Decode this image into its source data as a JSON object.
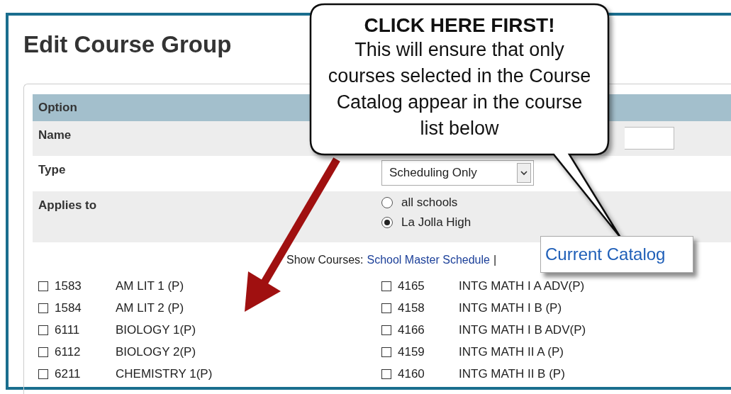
{
  "page": {
    "title": "Edit Course Group"
  },
  "table": {
    "header": "Option",
    "rows": [
      {
        "kind": "input",
        "label": "Name"
      },
      {
        "kind": "select",
        "label": "Type",
        "value": "Scheduling Only"
      },
      {
        "kind": "radio",
        "label": "Applies to",
        "options": [
          {
            "label": "all schools",
            "selected": false
          },
          {
            "label": "La Jolla High",
            "selected": true
          }
        ]
      }
    ]
  },
  "show_courses": {
    "label": "Show Courses:",
    "links": [
      "School Master Schedule"
    ],
    "separator": "|"
  },
  "courses": [
    [
      {
        "code": "1583",
        "name": "AM LIT 1 (P)",
        "checked": false
      },
      {
        "code": "4165",
        "name": "INTG MATH I A ADV(P)",
        "checked": false
      }
    ],
    [
      {
        "code": "1584",
        "name": "AM LIT 2 (P)",
        "checked": false
      },
      {
        "code": "4158",
        "name": "INTG MATH I B (P)",
        "checked": false
      }
    ],
    [
      {
        "code": "6111",
        "name": "BIOLOGY 1(P)",
        "checked": false
      },
      {
        "code": "4166",
        "name": "INTG MATH I B ADV(P)",
        "checked": false
      }
    ],
    [
      {
        "code": "6112",
        "name": "BIOLOGY 2(P)",
        "checked": false
      },
      {
        "code": "4159",
        "name": "INTG MATH II A (P)",
        "checked": false
      }
    ],
    [
      {
        "code": "6211",
        "name": "CHEMISTRY 1(P)",
        "checked": false
      },
      {
        "code": "4160",
        "name": "INTG MATH II B (P)",
        "checked": false
      }
    ]
  ],
  "annotation": {
    "heading": "CLICK HERE FIRST!",
    "body": "This will ensure that only courses selected in the Course Catalog appear in the course list below",
    "highlight": "Current Catalog"
  }
}
